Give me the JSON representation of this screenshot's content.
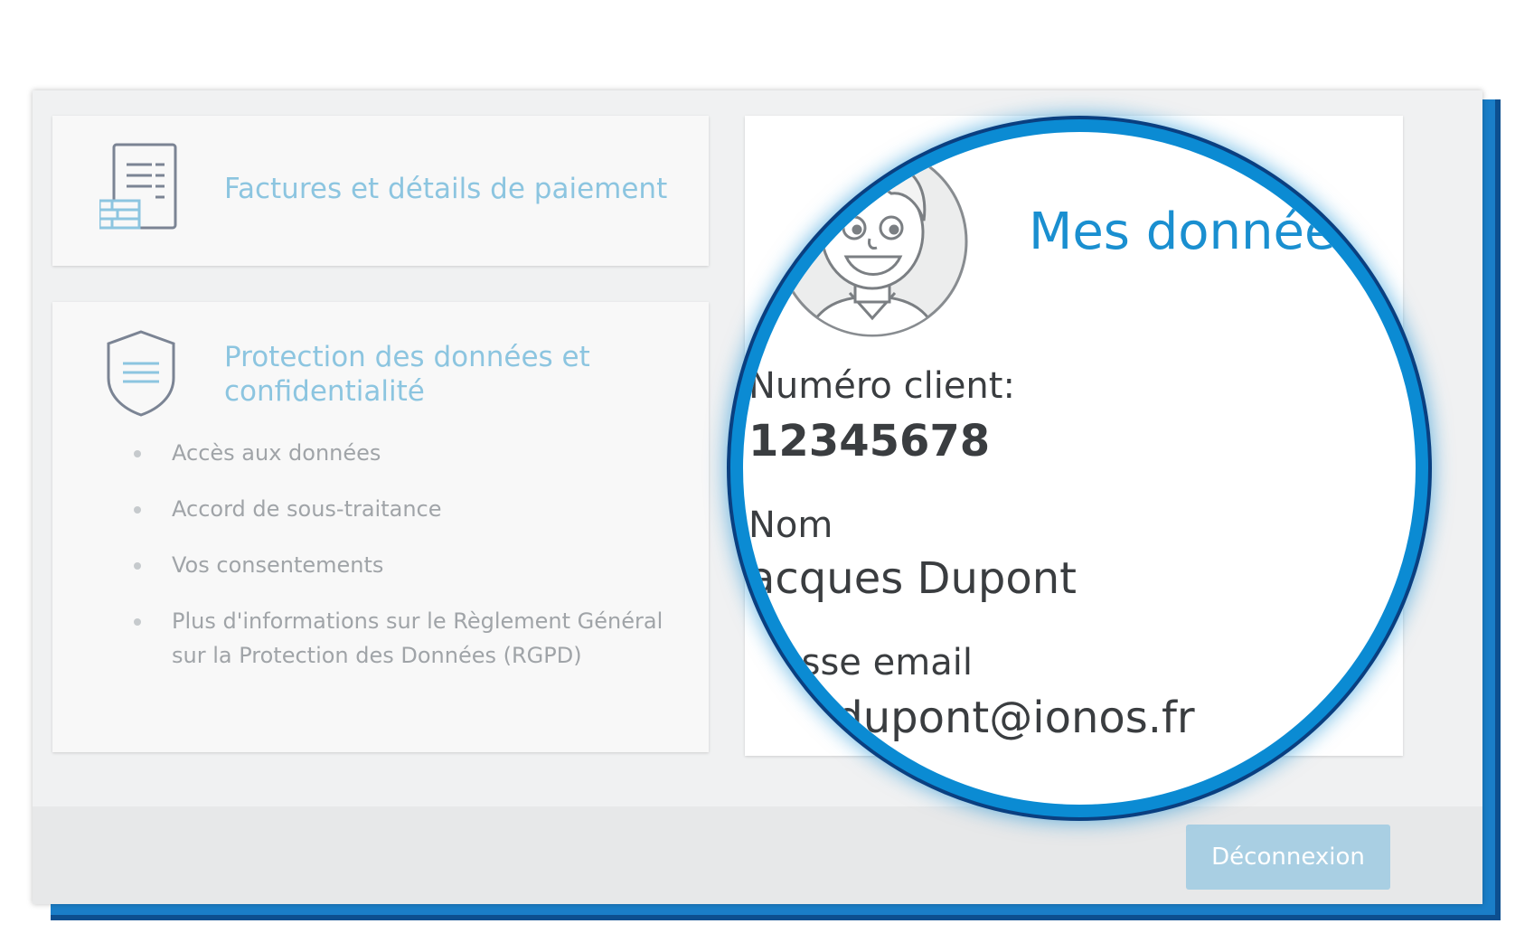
{
  "invoices": {
    "title": "Factures et détails de paiement",
    "icon": "invoice-document-icon"
  },
  "privacy": {
    "title": "Protection des données et confidentialité",
    "icon": "shield-icon",
    "links": [
      "Accès aux données",
      "Accord de sous-traitance",
      "Vos consentements",
      "Plus d'informations sur le Règlement Général sur la Protection des Données (RGPD)"
    ]
  },
  "my_data": {
    "title": "Mes données",
    "avatar": "user-avatar-illustration",
    "customer_number_label": "Numéro client:",
    "customer_number": "12345678",
    "name_label": "Nom",
    "name_value": "acques Dupont",
    "email_label": "esse email",
    "email_value": "s.dupont@ionos.fr"
  },
  "footer": {
    "logout_label": "Déconnexion"
  },
  "colors": {
    "accent": "#1a8fd0",
    "muted_link": "#8cc5e0",
    "button_bg": "#a9cfe3",
    "magnifier_ring": "#0b8bd3"
  }
}
